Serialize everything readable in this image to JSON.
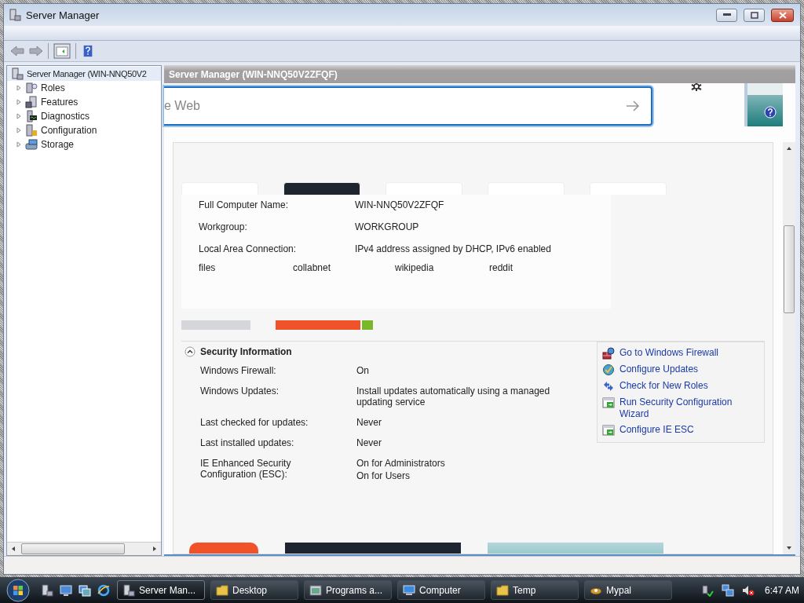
{
  "window": {
    "title": "Server Manager"
  },
  "tree": {
    "root": {
      "label": "Server Manager (WIN-NNQ50V2",
      "selected": true
    },
    "items": [
      {
        "label": "Roles",
        "expanded": false
      },
      {
        "label": "Features",
        "expanded": false
      },
      {
        "label": "Diagnostics",
        "expanded": false
      },
      {
        "label": "Configuration",
        "expanded": false
      },
      {
        "label": "Storage",
        "expanded": false
      }
    ]
  },
  "header": "Server Manager (WIN-NNQ50V2ZFQF)",
  "search": {
    "placeholder": "e Web"
  },
  "computer_info": [
    {
      "label": "Full Computer Name:",
      "value": "WIN-NNQ50V2ZFQF"
    },
    {
      "label": "Workgroup:",
      "value": "WORKGROUP"
    },
    {
      "label": "Local Area Connection:",
      "value": "IPv4 address assigned by DHCP, IPv6 enabled"
    }
  ],
  "tiles": [
    "files",
    "collabnet",
    "wikipedia",
    "reddit"
  ],
  "security": {
    "title": "Security Information",
    "expanded": true,
    "rows": [
      {
        "label": "Windows Firewall:",
        "value": [
          "On"
        ]
      },
      {
        "label": "Windows Updates:",
        "value": [
          "Install updates automatically using a managed updating service"
        ]
      },
      {
        "label": "Last checked for updates:",
        "value": [
          "Never"
        ]
      },
      {
        "label": "Last installed updates:",
        "value": [
          "Never"
        ]
      },
      {
        "label": "IE Enhanced Security Configuration (ESC):",
        "value": [
          "On for Administrators",
          "On for Users"
        ]
      }
    ],
    "links": [
      "Go to Windows Firewall",
      "Configure Updates",
      "Check for New Roles",
      "Run Security Configuration Wizard",
      "Configure IE ESC"
    ]
  },
  "taskbar": {
    "buttons": [
      {
        "label": "Server Man...",
        "selected": true
      },
      {
        "label": "Desktop",
        "selected": false
      },
      {
        "label": "Programs a...",
        "selected": false
      },
      {
        "label": "Computer",
        "selected": false
      },
      {
        "label": "Temp",
        "selected": false
      },
      {
        "label": "Mypal",
        "selected": false
      }
    ],
    "clock": "6:47 AM"
  }
}
